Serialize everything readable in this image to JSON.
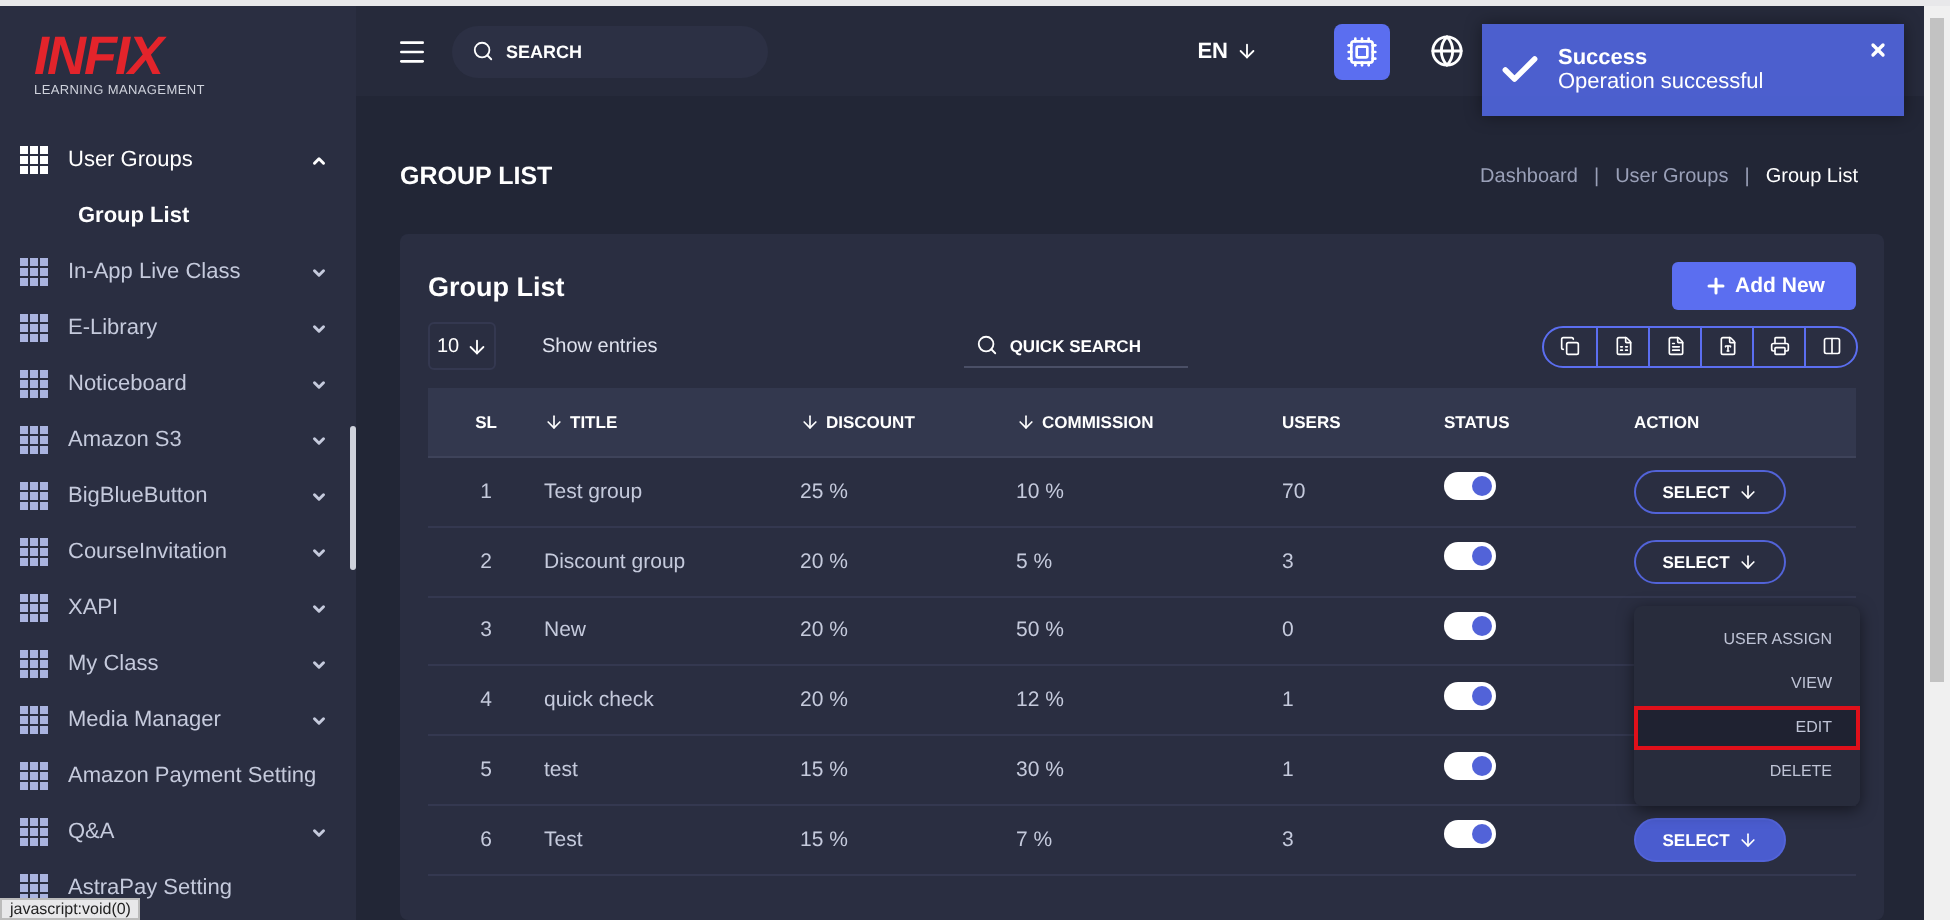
{
  "logo": {
    "brand": "INFIX",
    "tagline": "LEARNING MANAGEMENT"
  },
  "sidebar": {
    "items": [
      {
        "label": "User Groups",
        "expandable": true,
        "expanded": true,
        "children": [
          {
            "label": "Group List",
            "selected": true
          }
        ]
      },
      {
        "label": "In-App Live Class",
        "expandable": true,
        "expanded": false
      },
      {
        "label": "E-Library",
        "expandable": true,
        "expanded": false
      },
      {
        "label": "Noticeboard",
        "expandable": true,
        "expanded": false
      },
      {
        "label": "Amazon S3",
        "expandable": true,
        "expanded": false
      },
      {
        "label": "BigBlueButton",
        "expandable": true,
        "expanded": false
      },
      {
        "label": "CourseInvitation",
        "expandable": true,
        "expanded": false
      },
      {
        "label": "XAPI",
        "expandable": true,
        "expanded": false
      },
      {
        "label": "My Class",
        "expandable": true,
        "expanded": false
      },
      {
        "label": "Media Manager",
        "expandable": true,
        "expanded": false
      },
      {
        "label": "Amazon Payment Setting",
        "expandable": false,
        "expanded": false
      },
      {
        "label": "Q&A",
        "expandable": true,
        "expanded": false
      },
      {
        "label": "AstraPay Setting",
        "expandable": false,
        "expanded": false
      }
    ]
  },
  "topbar": {
    "search_placeholder": "SEARCH",
    "language": "EN"
  },
  "toast": {
    "title": "Success",
    "message": "Operation successful"
  },
  "page_title": "GROUP LIST",
  "breadcrumb_separator": "|",
  "breadcrumb": [
    {
      "label": "Dashboard",
      "selected": false
    },
    {
      "label": "User Groups",
      "selected": false
    },
    {
      "label": "Group List",
      "selected": true
    }
  ],
  "card": {
    "title": "Group List",
    "add_button": "Add New",
    "page_size": "10",
    "show_entries": "Show entries",
    "quick_search": "QUICK SEARCH",
    "columns": [
      {
        "label": "SL",
        "sortable": false
      },
      {
        "label": "TITLE",
        "sortable": true
      },
      {
        "label": "DISCOUNT",
        "sortable": true
      },
      {
        "label": "COMMISSION",
        "sortable": true
      },
      {
        "label": "USERS",
        "sortable": false
      },
      {
        "label": "STATUS",
        "sortable": false
      },
      {
        "label": "ACTION",
        "sortable": false
      }
    ],
    "rows": [
      {
        "sl": "1",
        "title": "Test group",
        "discount": "25 %",
        "commission": "10 %",
        "users": "70",
        "status_on": true,
        "action": "SELECT",
        "menu_open": false
      },
      {
        "sl": "2",
        "title": "Discount group",
        "discount": "20 %",
        "commission": "5 %",
        "users": "3",
        "status_on": true,
        "action": "SELECT",
        "menu_open": false
      },
      {
        "sl": "3",
        "title": "New",
        "discount": "20 %",
        "commission": "50 %",
        "users": "0",
        "status_on": true
      },
      {
        "sl": "4",
        "title": "quick check",
        "discount": "20 %",
        "commission": "12 %",
        "users": "1",
        "status_on": true
      },
      {
        "sl": "5",
        "title": "test",
        "discount": "15 %",
        "commission": "30 %",
        "users": "1",
        "status_on": true
      },
      {
        "sl": "6",
        "title": "Test",
        "discount": "15 %",
        "commission": "7 %",
        "users": "3",
        "status_on": true,
        "action": "SELECT",
        "menu_open": true
      }
    ],
    "action_menu": [
      {
        "label": "USER ASSIGN",
        "highlighted": false
      },
      {
        "label": "VIEW",
        "highlighted": false
      },
      {
        "label": "EDIT",
        "highlighted": true
      },
      {
        "label": "DELETE",
        "highlighted": false
      }
    ]
  },
  "status_bar": "javascript:void(0)"
}
